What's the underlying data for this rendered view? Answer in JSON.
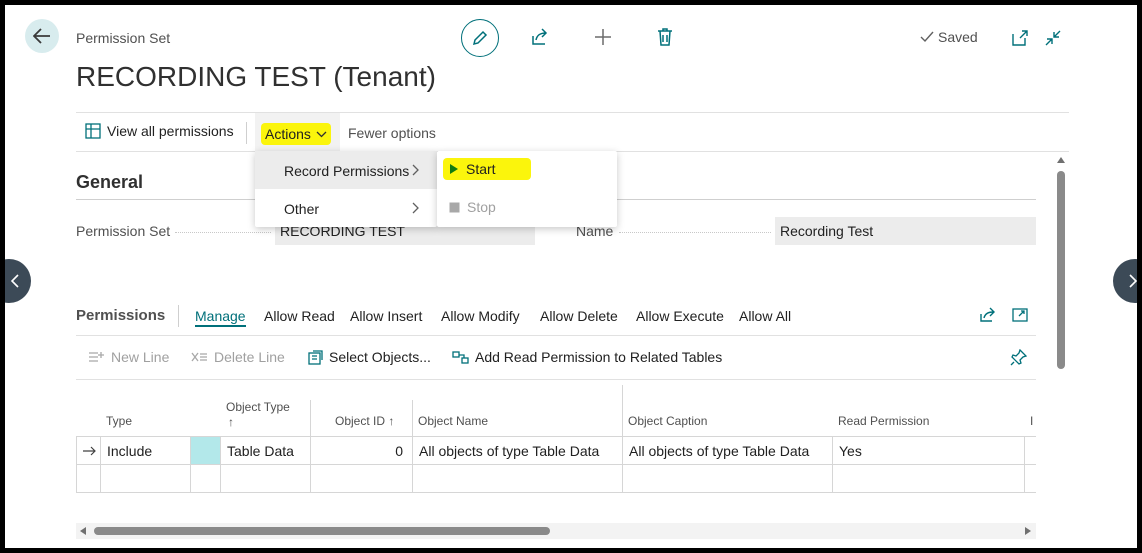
{
  "header": {
    "breadcrumb": "Permission Set",
    "title": "RECORDING TEST (Tenant)",
    "status": "Saved"
  },
  "action_bar": {
    "view_all": "View all permissions",
    "actions": "Actions",
    "fewer_options": "Fewer options"
  },
  "actions_menu": {
    "items": [
      "Record Permissions",
      "Other"
    ],
    "submenu": [
      "Start",
      "Stop"
    ]
  },
  "general": {
    "section_title": "General",
    "permission_set_label": "Permission Set",
    "permission_set_value": "RECORDING TEST",
    "name_label": "Name",
    "name_value": "Recording Test"
  },
  "permissions": {
    "section_title": "Permissions",
    "tabs": [
      "Manage",
      "Allow Read",
      "Allow Insert",
      "Allow Modify",
      "Allow Delete",
      "Allow Execute",
      "Allow All"
    ],
    "toolbar": {
      "new_line": "New Line",
      "delete_line": "Delete Line",
      "select_objects": "Select Objects...",
      "add_read": "Add Read Permission to Related Tables"
    },
    "columns": {
      "type": "Type",
      "object_type": "Object Type",
      "sort_arrow": "↑",
      "object_id": "Object ID ↑",
      "object_name": "Object Name",
      "object_caption": "Object Caption",
      "read_permission": "Read Permission",
      "insert_permission_partial": "I"
    },
    "rows": [
      {
        "type": "Include",
        "object_type": "Table Data",
        "object_id": "0",
        "object_name": "All objects of type Table Data",
        "object_caption": "All objects of type Table Data",
        "read_permission": "Yes"
      }
    ]
  },
  "colors": {
    "accent": "#00707a",
    "highlight": "#fbf50c",
    "field_bg": "#ececec",
    "selected_cell": "#b3e8ea"
  }
}
